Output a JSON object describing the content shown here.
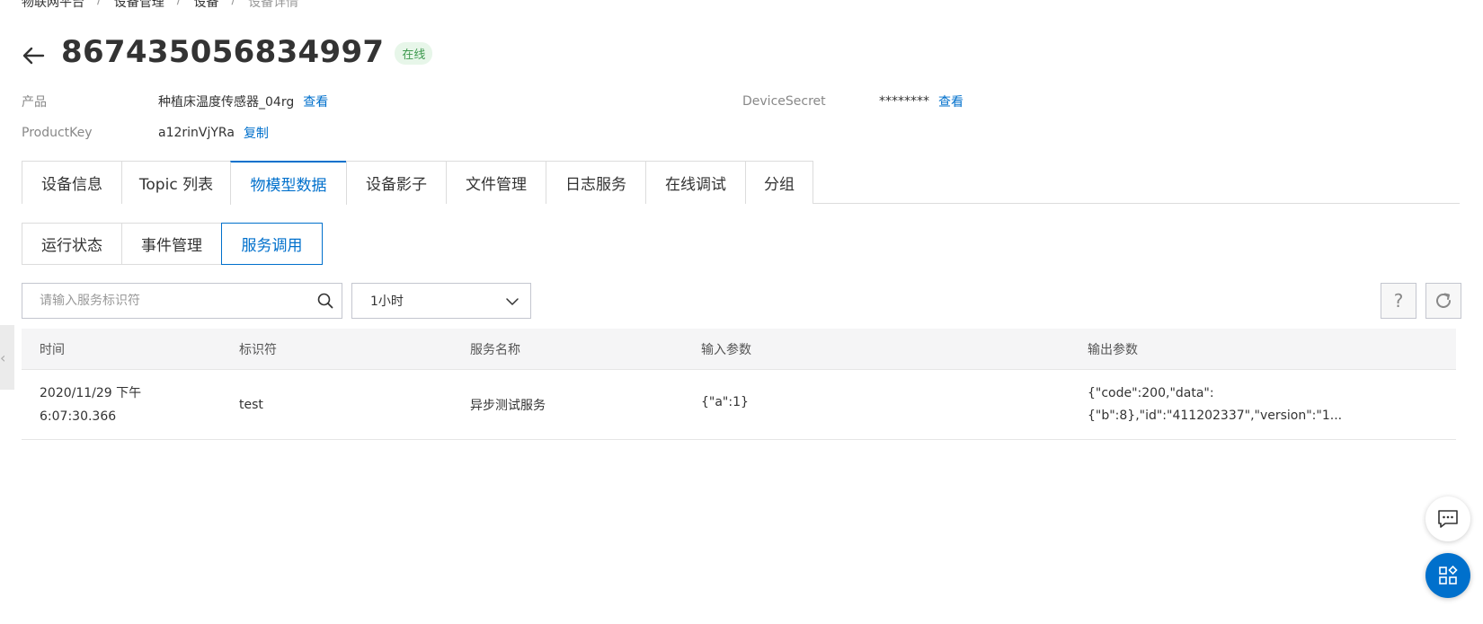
{
  "breadcrumb": [
    "物联网平台",
    "设备管理",
    "设备",
    "设备详情"
  ],
  "device": {
    "name": "867435056834997",
    "status": "在线"
  },
  "meta": {
    "product_label": "产品",
    "product_value": "种植床温度传感器_04rg",
    "product_link": "查看",
    "productkey_label": "ProductKey",
    "productkey_value": "a12rinVjYRa",
    "productkey_link": "复制",
    "secret_label": "DeviceSecret",
    "secret_value": "********",
    "secret_link": "查看"
  },
  "main_tabs": [
    "设备信息",
    "Topic 列表",
    "物模型数据",
    "设备影子",
    "文件管理",
    "日志服务",
    "在线调试",
    "分组"
  ],
  "active_main_tab": "物模型数据",
  "sub_tabs": [
    "运行状态",
    "事件管理",
    "服务调用"
  ],
  "active_sub_tab": "服务调用",
  "search": {
    "placeholder": "请输入服务标识符"
  },
  "time_select": {
    "value": "1小时"
  },
  "help_label": "?",
  "table": {
    "headers": [
      "时间",
      "标识符",
      "服务名称",
      "输入参数",
      "输出参数"
    ],
    "rows": [
      {
        "time_line1": "2020/11/29 下午",
        "time_line2": "6:07:30.366",
        "identifier": "test",
        "service_name": "异步测试服务",
        "input": "{\"a\":1}",
        "output_line1": "{\"code\":200,\"data\":",
        "output_line2": "{\"b\":8},\"id\":\"411202337\",\"version\":\"1..."
      }
    ]
  },
  "colors": {
    "accent": "#0070cc",
    "status_bg": "#e7f6e9",
    "status_text": "#3e9a4f"
  },
  "icons": [
    "back-arrow-icon",
    "search-icon",
    "chevron-down-icon",
    "help-icon",
    "refresh-icon",
    "chevron-left-icon",
    "chat-icon",
    "apps-icon"
  ]
}
